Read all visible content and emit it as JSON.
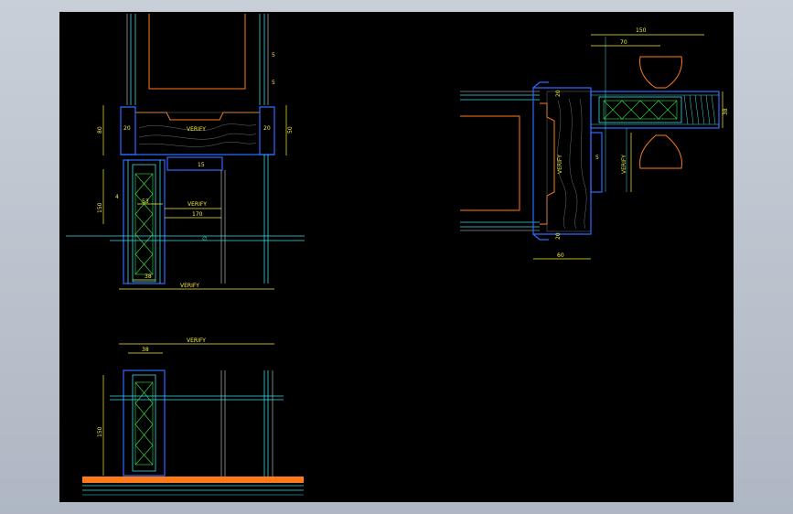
{
  "drawing": {
    "background": "#000000",
    "frame_color": "#b8c0cc",
    "colors": {
      "dimension": "#f5ee3a",
      "cyan": "#3fd9e6",
      "blue": "#2f6bff",
      "orange": "#ff7a1a",
      "green": "#37e04a",
      "white": "#cfd3d8"
    }
  },
  "detail_top_left": {
    "labels": {
      "verify_top": "VERIFY",
      "verify_mid": "VERIFY",
      "verify_bottom": "VERIFY",
      "d20_left": "20",
      "d20_right": "20",
      "d80": "80",
      "d50": "50",
      "d150": "150",
      "d15": "15",
      "d53": "53",
      "d170": "170",
      "d38": "38",
      "d5a": "5",
      "d5b": "5",
      "d4": "4"
    }
  },
  "detail_bottom_left": {
    "labels": {
      "verify": "VERIFY",
      "d38": "38",
      "d150": "150"
    }
  },
  "detail_right": {
    "labels": {
      "d150": "150",
      "d70": "70",
      "d20_top": "20",
      "d20_bottom": "20",
      "d60": "60",
      "d38": "38",
      "verify_left": "VERIFY",
      "verify_right": "VERIFY",
      "d5": "5"
    }
  }
}
